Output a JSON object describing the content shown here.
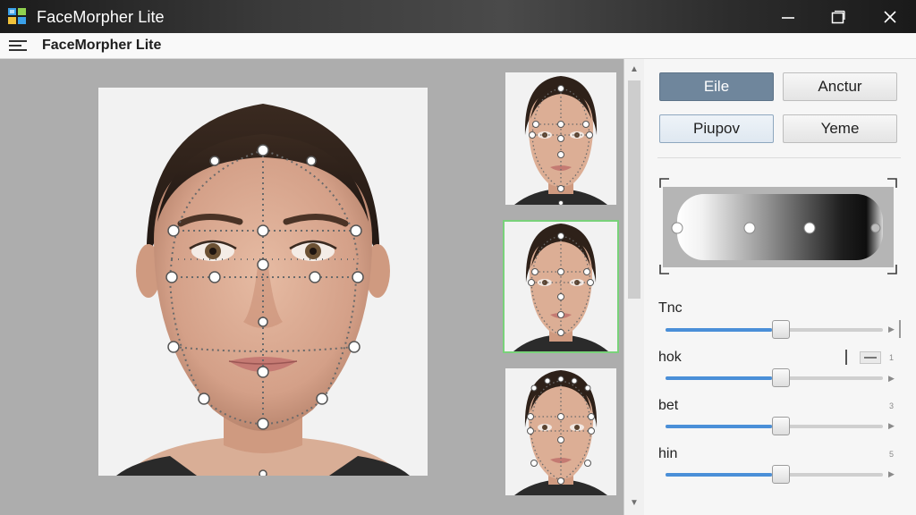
{
  "window": {
    "title": "FaceMorpher Lite"
  },
  "menubar": {
    "title": "FaceMorpher Lite"
  },
  "icons": {
    "app": "app-logo-icon",
    "menu": "hamburger-menu-icon",
    "minimize": "minimize-icon",
    "maximize": "maximize-icon",
    "close": "close-icon"
  },
  "panel": {
    "buttons": [
      {
        "label": "Eile",
        "state": "selected"
      },
      {
        "label": "Anctur",
        "state": "normal"
      },
      {
        "label": "Piupov",
        "state": "focused"
      },
      {
        "label": "Yeme",
        "state": "normal"
      }
    ],
    "sliders": [
      {
        "label": "Tnc",
        "value": 0.49,
        "end_mark": ""
      },
      {
        "label": "hok",
        "value": 0.49,
        "end_mark": "1"
      },
      {
        "label": "bet",
        "value": 0.49,
        "end_mark": "3"
      },
      {
        "label": "hin",
        "value": 0.49,
        "end_mark": "5"
      }
    ]
  },
  "thumbnails": {
    "selected_index": 1,
    "count": 3
  },
  "colors": {
    "accent": "#4a8fd8",
    "selected_button": "#6f869c",
    "thumbnail_selected_border": "#79d27a",
    "landmark_line": "#6a6a6a"
  }
}
